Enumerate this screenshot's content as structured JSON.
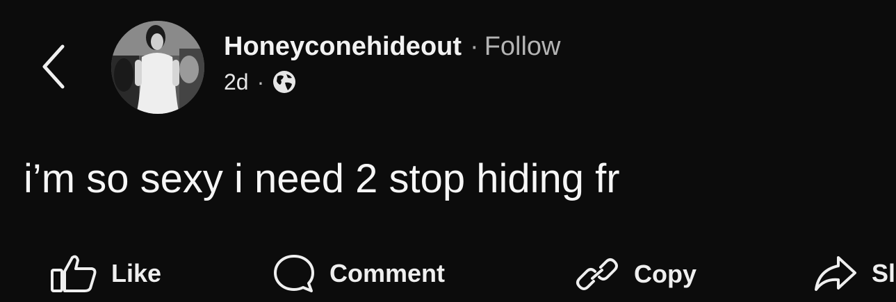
{
  "header": {
    "username": "Honeyconehideout",
    "separator": "·",
    "follow_label": "Follow",
    "timestamp": "2d",
    "meta_separator": "·",
    "privacy_icon": "globe-icon",
    "back_icon": "chevron-left-icon",
    "avatar": "profile-avatar"
  },
  "post": {
    "text": "i’m so sexy i need 2 stop hiding fr"
  },
  "actions": [
    {
      "label": "Like",
      "icon": "thumbs-up-icon"
    },
    {
      "label": "Comment",
      "icon": "comment-icon"
    },
    {
      "label": "Copy",
      "icon": "link-icon"
    },
    {
      "label": "Sl",
      "icon": "share-icon"
    }
  ],
  "colors": {
    "background": "#0c0c0c",
    "text": "#f2f2f2",
    "muted": "#b4b4b4"
  }
}
